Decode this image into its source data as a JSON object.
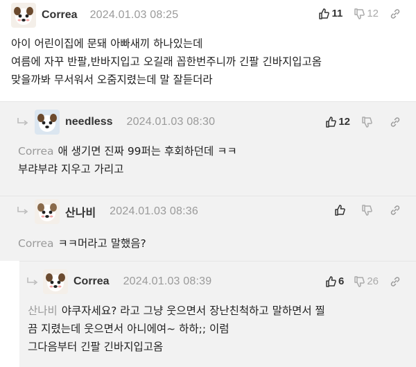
{
  "comments": [
    {
      "nick": "Correa",
      "date": "2024.01.03 08:25",
      "up": "11",
      "down": "12",
      "lines": [
        "아이 어린이집에 문돼 아빠새끼 하나있는데",
        "여름에 자꾸 반팔,반바지입고 오길래 꼽한번주니까 긴팔 긴바지입고옴",
        "맞을까봐 무서워서 오줌지렸는데 말 잘듣더라"
      ]
    },
    {
      "nick": "needless",
      "date": "2024.01.03 08:30",
      "up": "12",
      "down": "",
      "ref": "Correa",
      "lines": [
        "애 생기면 진짜 99퍼는 후회하던데 ㅋㅋ",
        "부랴부랴 지우고 가리고"
      ]
    },
    {
      "nick": "산나비",
      "date": "2024.01.03 08:36",
      "up": "",
      "down": "",
      "ref": "Correa",
      "lines": [
        "ㅋㅋ머라고 말했음?"
      ]
    },
    {
      "nick": "Correa",
      "date": "2024.01.03 08:39",
      "up": "6",
      "down": "26",
      "ref": "산나비",
      "lines": [
        "야쿠자세요? 라고 그냥 웃으면서 장난친척하고 말하면서 찔",
        "끔 지렸는데 웃으면서 아니에여~ 하하;; 이럼",
        "그다음부터 긴팔 긴바지입고옴"
      ]
    }
  ]
}
